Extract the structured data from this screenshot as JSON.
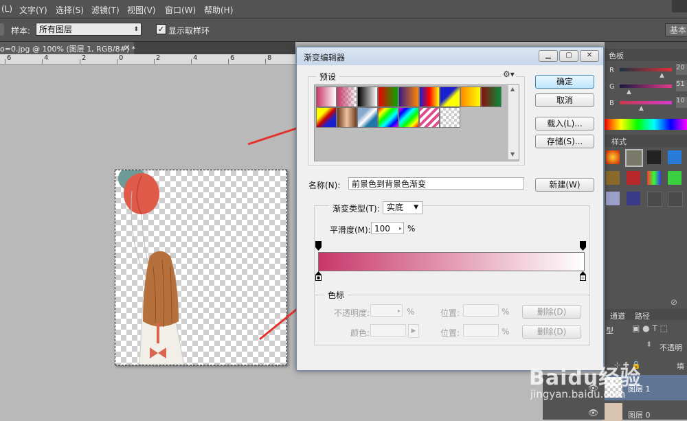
{
  "menubar": {
    "items": [
      "(L)",
      "文字(Y)",
      "选择(S)",
      "滤镜(T)",
      "视图(V)",
      "窗口(W)",
      "帮助(H)"
    ]
  },
  "options_bar": {
    "sample_label": "样本:",
    "sample_value": "所有图层",
    "show_ring_label": "显示取样环",
    "show_ring_checked": true,
    "right_button": "基本"
  },
  "document_tab": {
    "title": "o=0.jpg @ 100% (图层 1, RGB/8#) *",
    "close": "×"
  },
  "ruler": {
    "labels": [
      "6",
      "4",
      "2",
      "0",
      "2",
      "4",
      "6",
      "8"
    ]
  },
  "dialog": {
    "title": "渐变编辑器",
    "presets_label": "预设",
    "ok_label": "确定",
    "cancel_label": "取消",
    "load_label": "载入(L)...",
    "save_label": "存储(S)...",
    "name_label": "名称(N):",
    "name_value": "前景色到背景色渐变",
    "new_label": "新建(W)",
    "gradient_type_label": "渐变类型(T):",
    "gradient_type_value": "实底",
    "smoothness_label": "平滑度(M):",
    "smoothness_value": "100",
    "smoothness_unit": "%",
    "color_stop_group_label": "色标",
    "opacity_label": "不透明度:",
    "opacity_unit": "%",
    "position_label_1": "位置:",
    "position_unit_1": "%",
    "delete_label_1": "删除(D)",
    "color_label": "颜色:",
    "position_label_2": "位置:",
    "position_unit_2": "%",
    "delete_label_2": "删除(D)",
    "gradient_start_color": "#c8386a",
    "gradient_end_color": "#ffffff"
  },
  "right_panels": {
    "color_tab": "色板",
    "channels": [
      {
        "name": "R",
        "value": "20"
      },
      {
        "name": "G",
        "value": "51"
      },
      {
        "name": "B",
        "value": "10"
      }
    ],
    "styles_tab": "样式",
    "layers_tabs": [
      "通道",
      "路径"
    ],
    "kind_label": "型",
    "opacity_label": "不透明",
    "fill_label": "填",
    "layers": [
      {
        "name": "图层 1",
        "selected": true
      },
      {
        "name": "图层 0",
        "selected": false
      }
    ]
  },
  "watermark": {
    "brand": "Baidu经验",
    "url": "jingyan.baidu.com"
  }
}
